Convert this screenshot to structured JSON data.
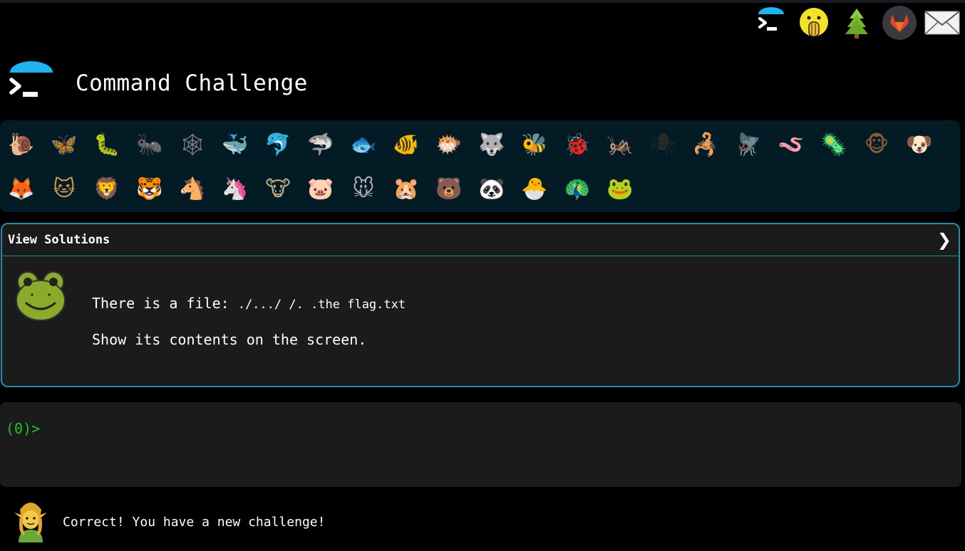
{
  "nav": {
    "icons": [
      {
        "name": "terminal-logo-icon"
      },
      {
        "name": "shushing-face-icon"
      },
      {
        "name": "tree-icon"
      },
      {
        "name": "gitlab-icon"
      },
      {
        "name": "envelope-icon"
      }
    ]
  },
  "header": {
    "title": "Command Challenge"
  },
  "animals": {
    "row1": [
      {
        "name": "snail",
        "glyph": "🐌",
        "color": "#8a6b3c"
      },
      {
        "name": "butterfly",
        "glyph": "🦋",
        "color": "#c9702a"
      },
      {
        "name": "caterpillar",
        "glyph": "🐛",
        "color": "#7bb83a"
      },
      {
        "name": "ant",
        "glyph": "🐜",
        "color": "#3a3a3a"
      },
      {
        "name": "spider-web",
        "glyph": "🕸",
        "color": "#8a8a8a"
      },
      {
        "name": "whale",
        "glyph": "🐳",
        "color": "#4f93c5"
      },
      {
        "name": "dolphin",
        "glyph": "🐬",
        "color": "#4f93c5"
      },
      {
        "name": "shark",
        "glyph": "🦈",
        "color": "#8aa4b3"
      },
      {
        "name": "fish",
        "glyph": "🐟",
        "color": "#5aa7d9"
      },
      {
        "name": "tropical-fish",
        "glyph": "🐠",
        "color": "#e0b12a"
      },
      {
        "name": "blowfish",
        "glyph": "🐡",
        "color": "#9a7a3a"
      },
      {
        "name": "wolf",
        "glyph": "🐺",
        "color": "#7a7a7a"
      },
      {
        "name": "bee",
        "glyph": "🐝",
        "color": "#e0c23a"
      },
      {
        "name": "ladybug",
        "glyph": "🐞",
        "color": "#cc2a2a"
      },
      {
        "name": "cricket",
        "glyph": "🦗",
        "color": "#6aa83a"
      },
      {
        "name": "spider",
        "glyph": "🕷",
        "color": "#2a2a2a"
      },
      {
        "name": "scorpion",
        "glyph": "🦂",
        "color": "#b8432a"
      },
      {
        "name": "fly",
        "glyph": "🪰",
        "color": "#5a5a5a"
      },
      {
        "name": "worm",
        "glyph": "🪱",
        "color": "#d97a9a"
      },
      {
        "name": "microbe",
        "glyph": "🦠",
        "color": "#5aa7d9"
      },
      {
        "name": "monkey",
        "glyph": "🐵",
        "color": "#8a5a3a"
      },
      {
        "name": "dog",
        "glyph": "🐶",
        "color": "#c9893a"
      }
    ],
    "row2": [
      {
        "name": "fox",
        "glyph": "🦊",
        "color": "#d9682a"
      },
      {
        "name": "cat",
        "glyph": "🐱",
        "color": "#d99a4a"
      },
      {
        "name": "lion",
        "glyph": "🦁",
        "color": "#c9923a"
      },
      {
        "name": "tiger",
        "glyph": "🐯",
        "color": "#e0822a"
      },
      {
        "name": "horse",
        "glyph": "🐴",
        "color": "#8a5a2a"
      },
      {
        "name": "unicorn",
        "glyph": "🦄",
        "color": "#e0e0f0"
      },
      {
        "name": "cow",
        "glyph": "🐮",
        "color": "#c9b08a"
      },
      {
        "name": "pig",
        "glyph": "🐷",
        "color": "#e0a0b0"
      },
      {
        "name": "mouse",
        "glyph": "🐭",
        "color": "#b0b0b0"
      },
      {
        "name": "hamster",
        "glyph": "🐹",
        "color": "#d9a060"
      },
      {
        "name": "bear",
        "glyph": "🐻",
        "color": "#6a4a2a"
      },
      {
        "name": "panda",
        "glyph": "🐼",
        "color": "#f0f0f0"
      },
      {
        "name": "hatching-chick",
        "glyph": "🐣",
        "color": "#e8d23a"
      },
      {
        "name": "peacock",
        "glyph": "🦚",
        "color": "#2a8a6a"
      },
      {
        "name": "frog",
        "glyph": "🐸",
        "color": "#b6d93a"
      }
    ]
  },
  "solutions": {
    "title": "View Solutions",
    "chevron": "❯",
    "line1_text": "There is a file: ",
    "line1_path": "./.../ /. .the flag.txt",
    "line2": "Show its contents on the screen."
  },
  "terminal": {
    "prompt": "(0)>",
    "value": ""
  },
  "status": {
    "message": "Correct! You have a new challenge!"
  },
  "colors": {
    "accent": "#1d8fb7",
    "prompt": "#22c226",
    "panel": "#1b1b1b",
    "animals_bg": "#031b24",
    "umbrella": "#1fb4f0"
  }
}
